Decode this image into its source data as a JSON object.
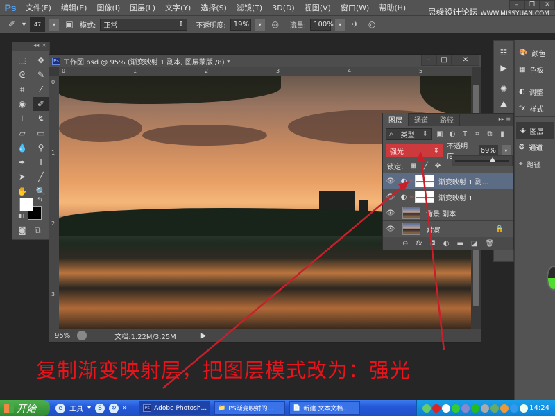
{
  "app": {
    "logo": "Ps",
    "menu": [
      "文件(F)",
      "编辑(E)",
      "图像(I)",
      "图层(L)",
      "文字(Y)",
      "选择(S)",
      "滤镜(T)",
      "3D(D)",
      "视图(V)",
      "窗口(W)",
      "帮助(H)"
    ],
    "watermark": "思缘设计论坛",
    "watermark_url": "WWW.MISSYUAN.COM",
    "window_controls": [
      "–",
      "❐",
      "✕"
    ]
  },
  "options_bar": {
    "brush_size": "47",
    "mode_label": "模式:",
    "mode_value": "正常",
    "opacity_label": "不透明度:",
    "opacity_value": "19%",
    "flow_label": "流量:",
    "flow_value": "100%"
  },
  "toolbox": {
    "tools": [
      {
        "name": "marquee",
        "glyph": "⬚"
      },
      {
        "name": "move",
        "glyph": "✥"
      },
      {
        "name": "lasso",
        "glyph": "ᘓ"
      },
      {
        "name": "quick-select",
        "glyph": "✎"
      },
      {
        "name": "crop",
        "glyph": "⌗"
      },
      {
        "name": "eyedropper",
        "glyph": "⁄"
      },
      {
        "name": "spot-healing",
        "glyph": "◉"
      },
      {
        "name": "brush",
        "glyph": "✐"
      },
      {
        "name": "clone-stamp",
        "glyph": "⊥"
      },
      {
        "name": "history-brush",
        "glyph": "↯"
      },
      {
        "name": "eraser",
        "glyph": "▱"
      },
      {
        "name": "gradient",
        "glyph": "▭"
      },
      {
        "name": "blur",
        "glyph": "💧"
      },
      {
        "name": "dodge",
        "glyph": "⚲"
      },
      {
        "name": "pen",
        "glyph": "✒"
      },
      {
        "name": "type",
        "glyph": "T"
      },
      {
        "name": "path-select",
        "glyph": "➤"
      },
      {
        "name": "line",
        "glyph": "╱"
      },
      {
        "name": "hand",
        "glyph": "✋"
      },
      {
        "name": "zoom",
        "glyph": "🔍"
      }
    ],
    "active_tool": "brush"
  },
  "document": {
    "title": "工作图.psd @ 95% (渐变映射 1 副本, 图层蒙版 /8) *",
    "ruler_h": [
      "0",
      "1",
      "2",
      "3",
      "4",
      "5"
    ],
    "ruler_v": [
      "0",
      "1",
      "2",
      "3"
    ],
    "zoom": "95%",
    "doc_info": "文档:1.22M/3.25M"
  },
  "layers_panel": {
    "tabs": [
      "图层",
      "通道",
      "路径"
    ],
    "active_tab": "图层",
    "filter_label": "类型",
    "blend_mode": "强光",
    "opacity_label": "不透明度:",
    "opacity_value": "69%",
    "opacity_fraction": 0.69,
    "lock_label": "锁定:",
    "layers": [
      {
        "name": "渐变映射 1 副...",
        "type": "adjustment",
        "visible": true,
        "selected": true
      },
      {
        "name": "渐变映射 1",
        "type": "adjustment",
        "visible": true,
        "selected": false
      },
      {
        "name": "背景 副本",
        "type": "image",
        "visible": true,
        "selected": false
      },
      {
        "name": "背景",
        "type": "image",
        "visible": true,
        "selected": false,
        "locked": true
      }
    ]
  },
  "dock": {
    "col2": [
      {
        "label": "颜色",
        "icon": "palette-icon"
      },
      {
        "label": "色板",
        "icon": "swatches-icon"
      },
      {
        "label": "调整",
        "icon": "adjustments-icon"
      },
      {
        "label": "样式",
        "icon": "styles-icon"
      },
      {
        "label": "图层",
        "icon": "layers-icon",
        "active": true
      },
      {
        "label": "通道",
        "icon": "channels-icon"
      },
      {
        "label": "路径",
        "icon": "paths-icon"
      }
    ]
  },
  "caption": "复制渐变映射层，把图层模式改为：强光",
  "taskbar": {
    "start": "开始",
    "toolbar_label": "工具",
    "tasks": [
      "Adobe Photosh...",
      "PS渐变映射的...",
      "新建 文本文档..."
    ],
    "clock": "14:24"
  }
}
